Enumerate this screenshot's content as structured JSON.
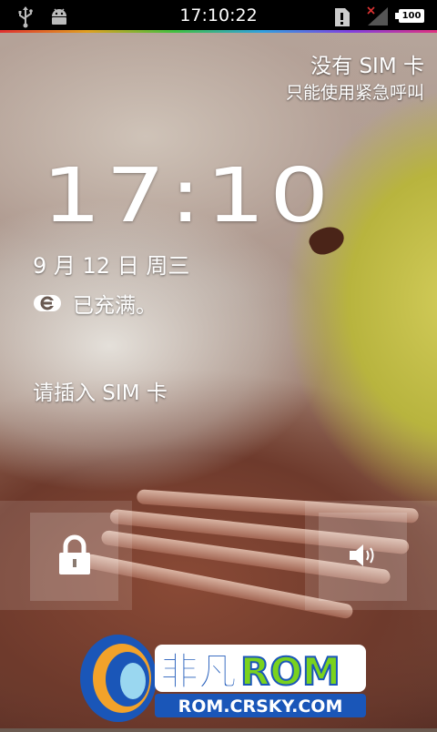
{
  "status_bar": {
    "time": "17:10:22",
    "battery": "100",
    "icons": [
      "usb-icon",
      "android-debug-icon",
      "alert-icon",
      "no-signal-icon",
      "battery-icon"
    ]
  },
  "carrier": {
    "line1": "没有 SIM 卡",
    "line2": "只能使用紧急呼叫"
  },
  "clock": {
    "time": "17:10"
  },
  "date": "9 月 12 日 周三",
  "charging": {
    "icon": "charging-icon",
    "status": "已充满。"
  },
  "sim_message": "请插入 SIM 卡",
  "controls": {
    "unlock_icon": "lock-icon",
    "sound_icon": "speaker-icon"
  },
  "watermark": {
    "brand_cn": "非凡",
    "brand_en": "ROM",
    "url": "ROM.CRSKY.COM"
  },
  "colors": {
    "status_bar_bg": "#000000",
    "watermark_blue": "#1a56b8",
    "watermark_green": "#7ad21e",
    "watermark_orange": "#f2a22a"
  }
}
